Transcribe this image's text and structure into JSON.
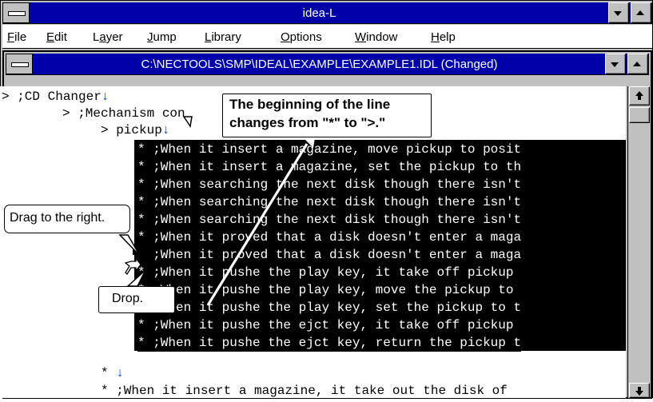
{
  "app": {
    "title": "idea-L"
  },
  "menu": [
    {
      "u": "F",
      "rest": "ile"
    },
    {
      "u": "E",
      "rest": "dit"
    },
    {
      "pre": "L",
      "u": "a",
      "rest": "yer"
    },
    {
      "u": "J",
      "rest": "ump"
    },
    {
      "u": "L",
      "rest": "ibrary"
    },
    {
      "u": "O",
      "rest": "ptions"
    },
    {
      "u": "W",
      "rest": "indow"
    },
    {
      "u": "H",
      "rest": "elp"
    }
  ],
  "document": {
    "title": "C:\\NECTOOLS\\SMP\\IDEAL\\EXAMPLE\\EXAMPLE1.IDL (Changed)"
  },
  "outline": {
    "l1": "> ;CD Changer",
    "l2": "> ;Mechanism con",
    "l3": "> pickup",
    "selected": [
      "* ;When it insert a magazine, move pickup to posit",
      "* ;When it insert a magazine, set the pickup to th",
      "* ;When searching the next disk though there isn't",
      "* ;When searching the next disk though there isn't",
      "* ;When searching the next disk though there isn't",
      "* ;When it proved that a disk doesn't enter a maga",
      "* ;When it proved that a disk doesn't enter a maga",
      "* ;When it pushe the play key, it take off pickup ",
      "* ;When it pushe the play key, move the pickup to ",
      "* ;When it pushe the play key, set the pickup to t",
      "* ;When it pushe the ejct key, it take off pickup ",
      "* ;When it pushe the ejct key, return the pickup t"
    ],
    "after1": "*",
    "after2": "* ;When it insert a magazine, it take out the disk of"
  },
  "callouts": {
    "beginning_line1": "The beginning of the line",
    "beginning_line2": "changes from \"*\" to \">.\"",
    "drag": "Drag to the right.",
    "drop": "Drop."
  }
}
